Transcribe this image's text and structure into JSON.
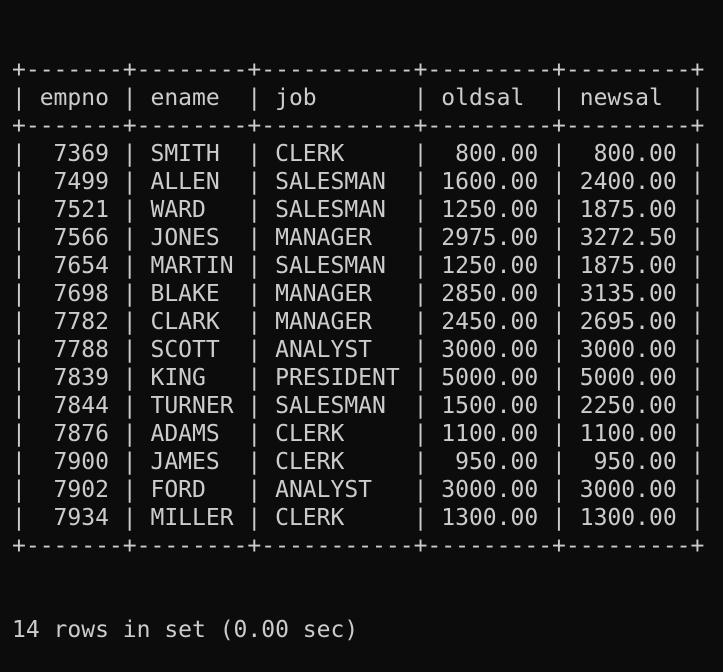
{
  "terminal": {
    "background": "#0c0c0c",
    "foreground": "#cccccc"
  },
  "table": {
    "columns": [
      {
        "name": "empno",
        "align": "right"
      },
      {
        "name": "ename",
        "align": "left"
      },
      {
        "name": "job",
        "align": "left"
      },
      {
        "name": "oldsal",
        "align": "right"
      },
      {
        "name": "newsal",
        "align": "right"
      }
    ],
    "rows": [
      [
        "7369",
        "SMITH",
        "CLERK",
        "800.00",
        "800.00"
      ],
      [
        "7499",
        "ALLEN",
        "SALESMAN",
        "1600.00",
        "2400.00"
      ],
      [
        "7521",
        "WARD",
        "SALESMAN",
        "1250.00",
        "1875.00"
      ],
      [
        "7566",
        "JONES",
        "MANAGER",
        "2975.00",
        "3272.50"
      ],
      [
        "7654",
        "MARTIN",
        "SALESMAN",
        "1250.00",
        "1875.00"
      ],
      [
        "7698",
        "BLAKE",
        "MANAGER",
        "2850.00",
        "3135.00"
      ],
      [
        "7782",
        "CLARK",
        "MANAGER",
        "2450.00",
        "2695.00"
      ],
      [
        "7788",
        "SCOTT",
        "ANALYST",
        "3000.00",
        "3000.00"
      ],
      [
        "7839",
        "KING",
        "PRESIDENT",
        "5000.00",
        "5000.00"
      ],
      [
        "7844",
        "TURNER",
        "SALESMAN",
        "1500.00",
        "2250.00"
      ],
      [
        "7876",
        "ADAMS",
        "CLERK",
        "1100.00",
        "1100.00"
      ],
      [
        "7900",
        "JAMES",
        "CLERK",
        "950.00",
        "950.00"
      ],
      [
        "7902",
        "FORD",
        "ANALYST",
        "3000.00",
        "3000.00"
      ],
      [
        "7934",
        "MILLER",
        "CLERK",
        "1300.00",
        "1300.00"
      ]
    ]
  },
  "footer": {
    "summary": "14 rows in set (0.00 sec)"
  }
}
